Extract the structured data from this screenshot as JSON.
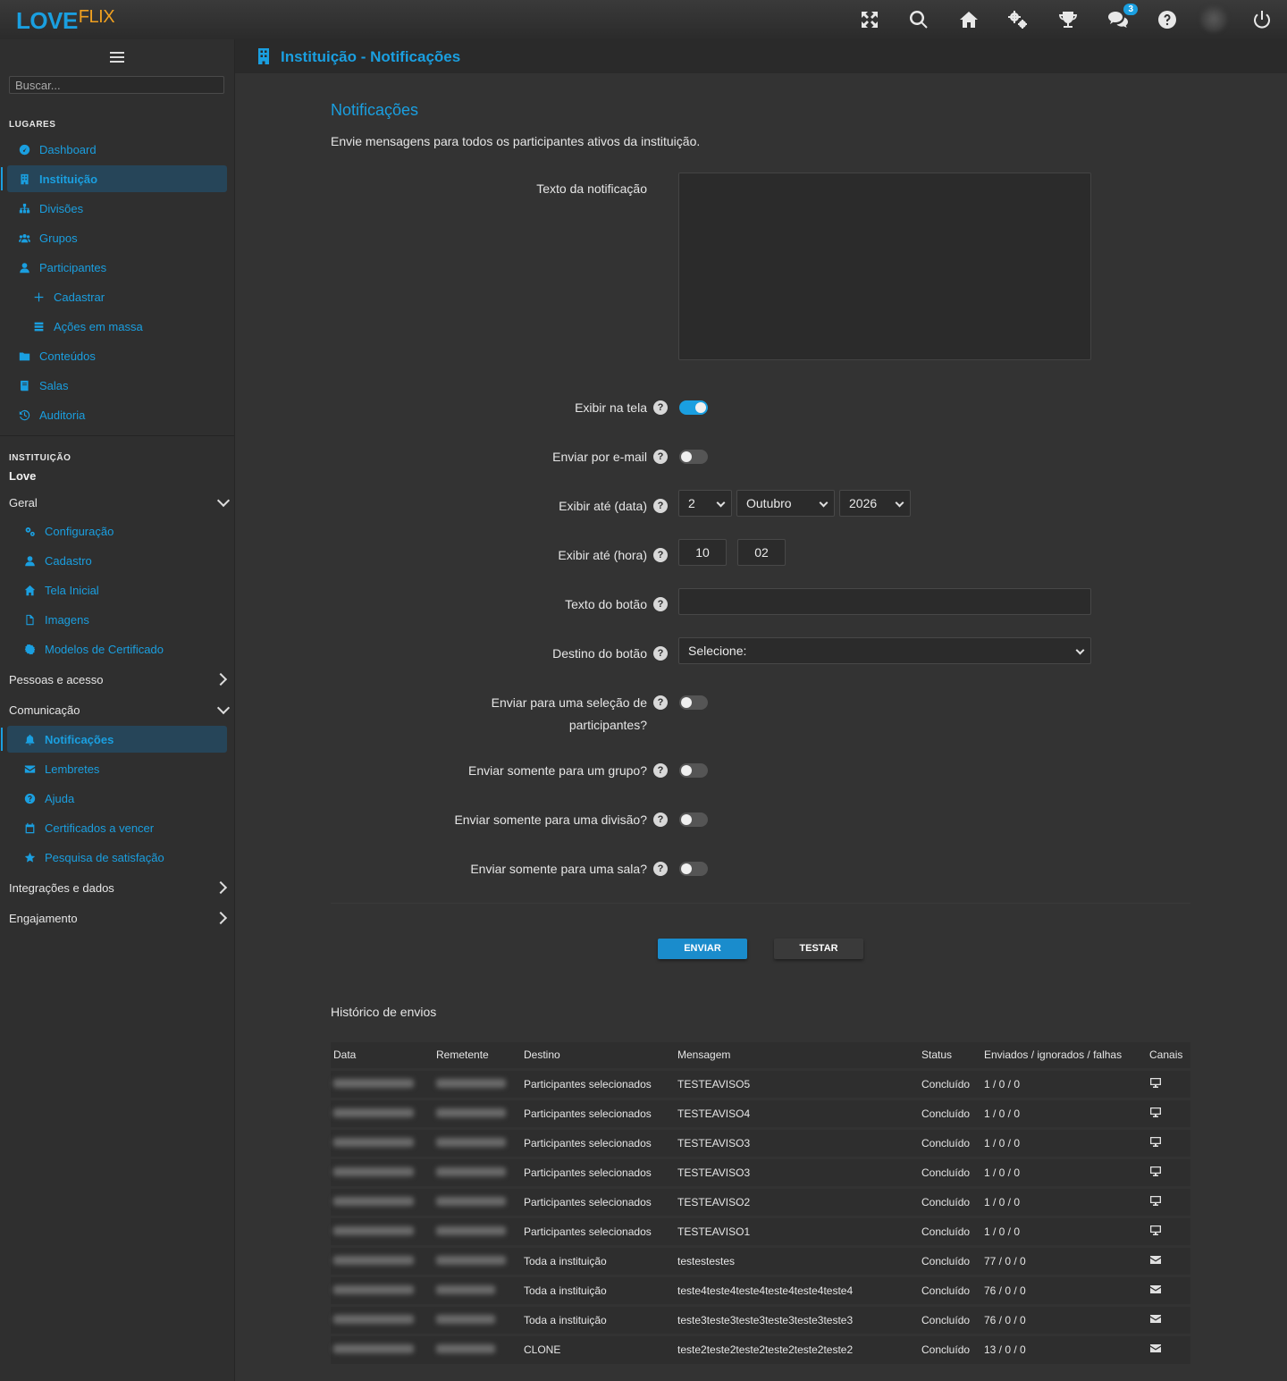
{
  "brand": {
    "love": "LOVE",
    "flix": "FLIX"
  },
  "topbar": {
    "icons": [
      "fullscreen-icon",
      "search-icon",
      "home-icon",
      "gears-icon",
      "trophy-icon",
      "chat-icon",
      "help-icon",
      "power-icon"
    ],
    "chat_badge": "3"
  },
  "sidebar": {
    "search_placeholder": "Buscar...",
    "places_title": "LUGARES",
    "places": [
      {
        "label": "Dashboard",
        "icon": "gauge-icon"
      },
      {
        "label": "Instituição",
        "icon": "building-icon"
      },
      {
        "label": "Divisões",
        "icon": "sitemap-icon"
      },
      {
        "label": "Grupos",
        "icon": "users-icon"
      },
      {
        "label": "Participantes",
        "icon": "user-icon"
      },
      {
        "label": "Cadastrar",
        "icon": "plus-icon"
      },
      {
        "label": "Ações em massa",
        "icon": "list-icon"
      },
      {
        "label": "Conteúdos",
        "icon": "folder-icon"
      },
      {
        "label": "Salas",
        "icon": "book-icon"
      },
      {
        "label": "Auditoria",
        "icon": "history-icon"
      }
    ],
    "institution_title": "INSTITUIÇÃO",
    "institution_name": "Love",
    "groups": {
      "geral": "Geral",
      "pessoas": "Pessoas e acesso",
      "comunicacao": "Comunicação",
      "integracoes": "Integrações e dados",
      "engajamento": "Engajamento"
    },
    "geral_items": [
      {
        "label": "Configuração",
        "icon": "gears-icon"
      },
      {
        "label": "Cadastro",
        "icon": "user-icon"
      },
      {
        "label": "Tela Inicial",
        "icon": "home-icon"
      },
      {
        "label": "Imagens",
        "icon": "file-icon"
      },
      {
        "label": "Modelos de Certificado",
        "icon": "certificate-icon"
      }
    ],
    "comunicacao_items": [
      {
        "label": "Notificações",
        "icon": "bell-icon"
      },
      {
        "label": "Lembretes",
        "icon": "envelope-icon"
      },
      {
        "label": "Ajuda",
        "icon": "question-icon"
      },
      {
        "label": "Certificados a vencer",
        "icon": "calendar-icon"
      },
      {
        "label": "Pesquisa de satisfação",
        "icon": "star-icon"
      }
    ]
  },
  "header": {
    "title": "Instituição - Notificações"
  },
  "main": {
    "title": "Notificações",
    "lead": "Envie mensagens para todos os participantes ativos da instituição.",
    "labels": {
      "texto": "Texto da notificação",
      "exibir_tela": "Exibir na tela",
      "email": "Enviar por e-mail",
      "data": "Exibir até (data)",
      "hora": "Exibir até (hora)",
      "botao_texto": "Texto do botão",
      "botao_destino": "Destino do botão",
      "selecao_1": "Enviar para uma seleção de",
      "selecao_2": "participantes?",
      "grupo": "Enviar somente para um grupo?",
      "divisao": "Enviar somente para uma divisão?",
      "sala": "Enviar somente para uma sala?"
    },
    "values": {
      "notification_text": "",
      "exibir_tela": true,
      "email": false,
      "day": "2",
      "month": "Outubro",
      "year": "2026",
      "hour": "10",
      "minute": "02",
      "botao_texto": "",
      "botao_destino": "Selecione:",
      "selecao": false,
      "grupo": false,
      "divisao": false,
      "sala": false
    },
    "help_glyph": "?",
    "send_button": "ENVIAR",
    "test_button": "TESTAR",
    "history_title": "Histórico de envios"
  },
  "history": {
    "columns": [
      "Data",
      "Remetente",
      "Destino",
      "Mensagem",
      "Status",
      "Enviados / ignorados / falhas",
      "Canais"
    ],
    "rows": [
      {
        "destino": "Participantes selecionados",
        "mensagem": "TESTEAVISO5",
        "status": "Concluído",
        "counts": "1 / 0 / 0",
        "canal": "screen-icon"
      },
      {
        "destino": "Participantes selecionados",
        "mensagem": "TESTEAVISO4",
        "status": "Concluído",
        "counts": "1 / 0 / 0",
        "canal": "screen-icon"
      },
      {
        "destino": "Participantes selecionados",
        "mensagem": "TESTEAVISO3",
        "status": "Concluído",
        "counts": "1 / 0 / 0",
        "canal": "screen-icon"
      },
      {
        "destino": "Participantes selecionados",
        "mensagem": "TESTEAVISO3",
        "status": "Concluído",
        "counts": "1 / 0 / 0",
        "canal": "screen-icon"
      },
      {
        "destino": "Participantes selecionados",
        "mensagem": "TESTEAVISO2",
        "status": "Concluído",
        "counts": "1 / 0 / 0",
        "canal": "screen-icon"
      },
      {
        "destino": "Participantes selecionados",
        "mensagem": "TESTEAVISO1",
        "status": "Concluído",
        "counts": "1 / 0 / 0",
        "canal": "screen-icon"
      },
      {
        "destino": "Toda a instituição",
        "mensagem": "testestestes",
        "status": "Concluído",
        "counts": "77 / 0 / 0",
        "canal": "envelope-icon"
      },
      {
        "destino": "Toda a instituição",
        "mensagem": "teste4teste4teste4teste4teste4teste4",
        "status": "Concluído",
        "counts": "76 / 0 / 0",
        "canal": "envelope-icon"
      },
      {
        "destino": "Toda a instituição",
        "mensagem": "teste3teste3teste3teste3teste3teste3",
        "status": "Concluído",
        "counts": "76 / 0 / 0",
        "canal": "envelope-icon"
      },
      {
        "destino": "CLONE",
        "mensagem": "teste2teste2teste2teste2teste2teste2",
        "status": "Concluído",
        "counts": "13 / 0 / 0",
        "canal": "envelope-icon"
      }
    ]
  },
  "colors": {
    "accent": "#1a9fe0",
    "brand_flix": "#f0a020",
    "background": "#333333",
    "sidebar": "#2f2f2f",
    "active_bg": "#264559"
  }
}
